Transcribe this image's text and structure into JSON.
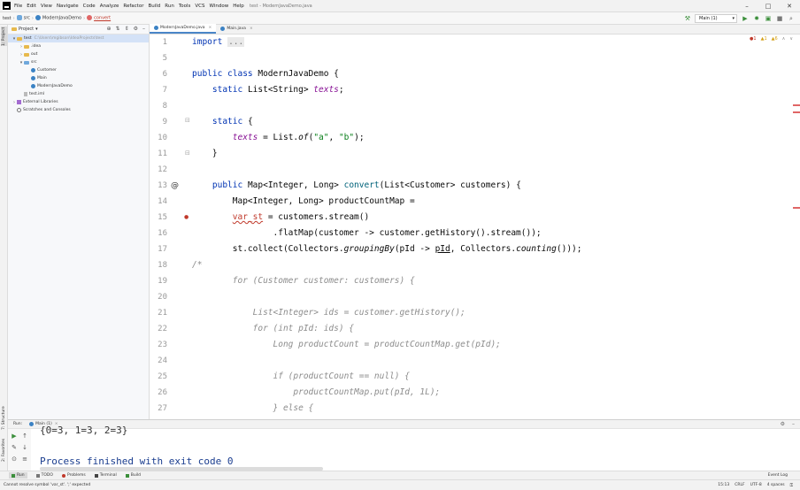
{
  "menu": {
    "items": [
      "File",
      "Edit",
      "View",
      "Navigate",
      "Code",
      "Analyze",
      "Refactor",
      "Build",
      "Run",
      "Tools",
      "VCS",
      "Window",
      "Help"
    ],
    "window_title": "test - ModernJavaDemo.java"
  },
  "nav": {
    "crumbs": [
      "test",
      "src",
      "ModernJavaDemo",
      "convert"
    ],
    "run_config": "Main (1)"
  },
  "project": {
    "title": "Project",
    "tree": [
      {
        "label": "test",
        "path": "C:\\Users\\mgibson\\IdeaProjects\\test",
        "kind": "folder",
        "depth": 0,
        "arrow": "▾",
        "selected": true
      },
      {
        "label": ".idea",
        "kind": "folder",
        "depth": 1,
        "arrow": "›"
      },
      {
        "label": "out",
        "kind": "folder",
        "depth": 1,
        "arrow": "›"
      },
      {
        "label": "src",
        "kind": "src",
        "depth": 1,
        "arrow": "▾"
      },
      {
        "label": "Customer",
        "kind": "class",
        "depth": 2,
        "arrow": ""
      },
      {
        "label": "Main",
        "kind": "class",
        "depth": 2,
        "arrow": ""
      },
      {
        "label": "ModernJavaDemo",
        "kind": "class",
        "depth": 2,
        "arrow": ""
      },
      {
        "label": "test.iml",
        "kind": "file",
        "depth": 1,
        "arrow": ""
      },
      {
        "label": "External Libraries",
        "kind": "lib",
        "depth": 0,
        "arrow": "›"
      },
      {
        "label": "Scratches and Consoles",
        "kind": "scratch",
        "depth": 0,
        "arrow": ""
      }
    ]
  },
  "editor": {
    "tabs": [
      {
        "label": "ModernJavaDemo.java",
        "active": true
      },
      {
        "label": "Main.java",
        "active": false
      }
    ],
    "line_numbers": [
      "1",
      "5",
      "6",
      "7",
      "8",
      "9",
      "10",
      "11",
      "12",
      "13",
      "14",
      "15",
      "16",
      "17",
      "18",
      "19",
      "20",
      "21",
      "22",
      "23",
      "24",
      "25",
      "26",
      "27"
    ],
    "indicators": [
      "●1",
      "▲1",
      "▲6",
      "∧",
      "∨"
    ]
  },
  "code": {
    "l1_kw": "import",
    "l1_fold": "...",
    "l5": "",
    "l6_kw": "public class",
    "l6_rest": " ModernJavaDemo {",
    "l7_kw": "static",
    "l7_type": " List<String> ",
    "l7_field": "texts",
    "l7_end": ";",
    "l8": "",
    "l9_kw": "static",
    "l9_rest": " {",
    "l10_field": "texts",
    "l10_mid": " = List.",
    "l10_fn": "of",
    "l10_open": "(",
    "l10_s1": "\"a\"",
    "l10_comma": ", ",
    "l10_s2": "\"b\"",
    "l10_end": ");",
    "l11": "}",
    "l12": "",
    "l13_kw": "public",
    "l13_rest": " Map<Integer, Long> ",
    "l13_fn": "convert",
    "l13_args": "(List<Customer> customers) {",
    "l14": "Map<Integer, Long> productCountMap =",
    "l15_var": "var_st",
    "l15_rest": " = customers.stream()",
    "l16": ".flatMap(customer -> customer.getHistory().stream());",
    "l17_a": "st.collect(Collectors.",
    "l17_fn1": "groupingBy",
    "l17_b": "(pId -> ",
    "l17_err": "pId",
    "l17_c": ", Collectors.",
    "l17_fn2": "counting",
    "l17_d": "()));",
    "l18": "/*",
    "l19": "for (Customer customer: customers) {",
    "l20": "",
    "l21": "List<Integer> ids = customer.getHistory();",
    "l22": "for (int pId: ids) {",
    "l23": "Long productCount = productCountMap.get(pId);",
    "l24": "",
    "l25": "if (productCount == null) {",
    "l26": "productCountMap.put(pId, 1L);",
    "l27": "} else {"
  },
  "run": {
    "label": "Run:",
    "tab": "Main (1)",
    "output_partial": "{0=3, 1=3, 2=3}",
    "output_done": "Process finished with exit code 0"
  },
  "bottom_tabs": [
    "Run",
    "TODO",
    "Problems",
    "Terminal",
    "Build"
  ],
  "event_log": "Event Log",
  "status": {
    "message": "Cannot resolve symbol 'var_st'. ';' expected",
    "right": [
      "15:13",
      "CRLF",
      "UTF-8",
      "4 spaces"
    ]
  },
  "colors": {
    "keyword": "#0033b3",
    "string": "#067d17",
    "field": "#871094",
    "error": "#c0392b",
    "selection": "#d4e2f7"
  }
}
